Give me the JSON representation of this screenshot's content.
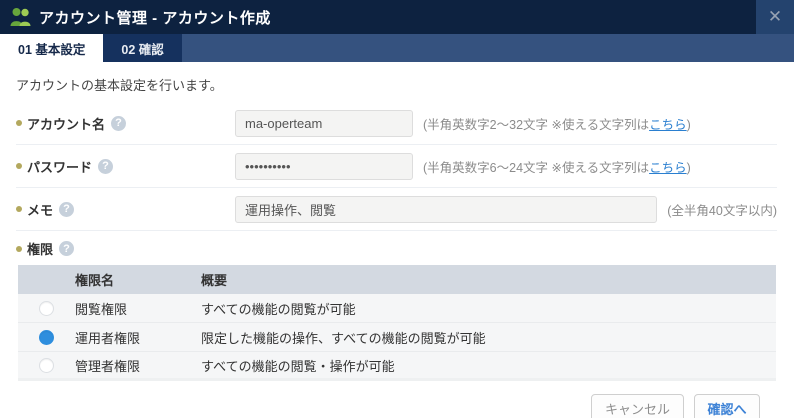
{
  "window": {
    "title": "アカウント管理 - アカウント作成",
    "close_icon": "✕"
  },
  "tabs": [
    {
      "label": "01 基本設定",
      "active": true
    },
    {
      "label": "02 確認",
      "active": false
    }
  ],
  "description": "アカウントの基本設定を行います。",
  "form": {
    "account_name": {
      "label": "アカウント名",
      "value": "ma-operteam",
      "hint_prefix": "(半角英数字2〜32文字 ※使える文字列は",
      "hint_link": "こちら",
      "hint_suffix": ")"
    },
    "password": {
      "label": "パスワード",
      "value": "••••••••••",
      "hint_prefix": "(半角英数字6〜24文字 ※使える文字列は",
      "hint_link": "こちら",
      "hint_suffix": ")"
    },
    "memo": {
      "label": "メモ",
      "value": "運用操作、閲覧",
      "hint": "(全半角40文字以内)"
    },
    "permission": {
      "label": "権限",
      "table": {
        "headers": [
          "権限名",
          "概要"
        ],
        "rows": [
          {
            "name": "閲覧権限",
            "summary": "すべての機能の閲覧が可能",
            "selected": false
          },
          {
            "name": "運用者権限",
            "summary": "限定した機能の操作、すべての機能の閲覧が可能",
            "selected": true
          },
          {
            "name": "管理者権限",
            "summary": "すべての機能の閲覧・操作が可能",
            "selected": false
          }
        ]
      }
    }
  },
  "footer": {
    "cancel_label": "キャンセル",
    "confirm_label": "確認へ"
  },
  "colors": {
    "titlebar_bg": "#0d2240",
    "tabbar_bg": "#35527f",
    "inactive_tab_bg": "#15315e",
    "table_header_bg": "#d3d9e1",
    "accent_blue": "#2e8ede",
    "link_blue": "#2a7fd0",
    "bullet_olive": "#b3a85e",
    "icon_green_dark": "#67a63c",
    "icon_green_light": "#9ecb54"
  }
}
